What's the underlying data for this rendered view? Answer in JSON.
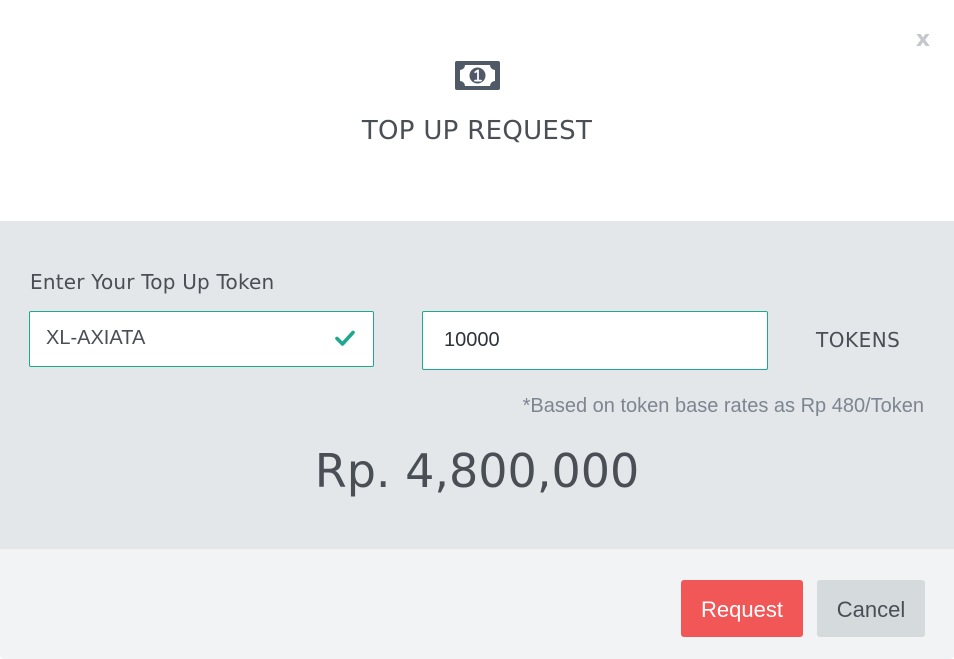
{
  "dialog": {
    "title": "TOP UP REQUEST",
    "close_label": "x",
    "header_icon": "banknote-icon"
  },
  "form": {
    "label": "Enter Your Top Up Token",
    "provider": {
      "value": "XL-AXIATA",
      "valid_icon": "check-icon"
    },
    "amount": {
      "value": "10000",
      "unit": "TOKENS"
    },
    "rate_note": "*Based on token base rates as Rp 480/Token",
    "total": "Rp. 4,800,000"
  },
  "actions": {
    "request_label": "Request",
    "cancel_label": "Cancel"
  },
  "colors": {
    "accent": "#1fa88f",
    "request_button": "#f25758",
    "cancel_button": "#d5dadd",
    "body_background": "#e4e7ea"
  }
}
